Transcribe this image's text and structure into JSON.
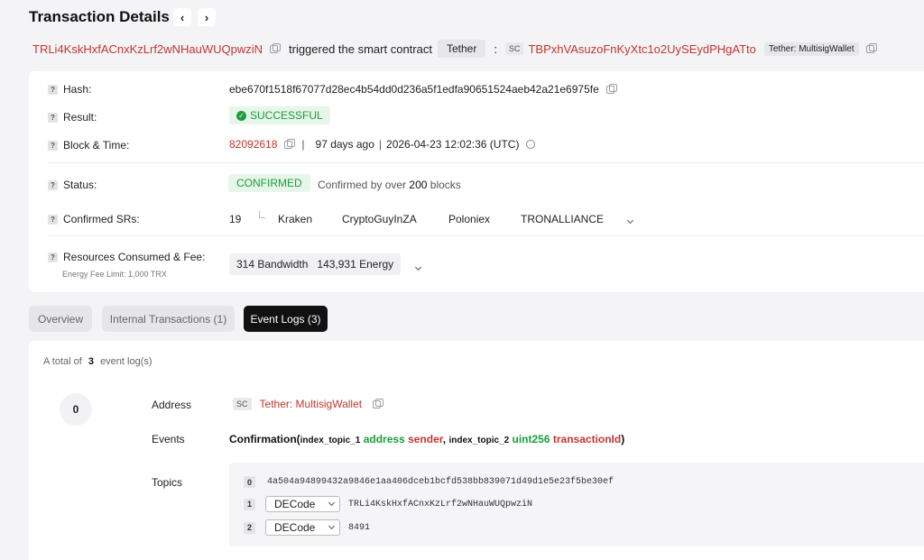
{
  "header": {
    "title": "Transaction Details",
    "prev_icon": "chevron-left",
    "next_icon": "chevron-right",
    "from_address": "TRLi4KskHxfACnxKzLrf2wNHauWUQpwziN",
    "triggered_text": "triggered the smart contract",
    "token_tag": "Tether",
    "colon": ":",
    "sc_label": "SC",
    "contract_address": "TBPxhVAsuzoFnKyXtc1o2UySEydPHgATto",
    "contract_tag": "Tether: MultisigWallet"
  },
  "details": {
    "hash_label": "Hash:",
    "hash_value": "ebe670f1518f67077d28ec4b54dd0d236a5f1edfa90651524aeb42a21e6975fe",
    "result_label": "Result:",
    "result_value": "SUCCESSFUL",
    "block_label": "Block & Time:",
    "block_number": "82092618",
    "sep": "|",
    "days_ago": "97 days ago",
    "timestamp": "2026-04-23 12:02:36 (UTC)",
    "status_label": "Status:",
    "status_value": "CONFIRMED",
    "confirmed_by_prefix": "Confirmed by over",
    "confirmed_count": "200",
    "confirmed_suffix": "blocks",
    "srs_label": "Confirmed SRs:",
    "srs_count": "19",
    "srs": [
      "Kraken",
      "CryptoGuyInZA",
      "Poloniex",
      "TRONALLIANCE"
    ],
    "resources_label": "Resources Consumed & Fee:",
    "energy_fee_limit": "Energy Fee Limit: 1,000 TRX",
    "bandwidth": "314 Bandwidth",
    "energy": "143,931 Energy"
  },
  "tabs": [
    "Overview",
    "Internal Transactions (1)",
    "Event Logs (3)"
  ],
  "events": {
    "total_prefix": "A total of",
    "total_count": "3",
    "total_suffix": "event log(s)",
    "index": "0",
    "address_label": "Address",
    "address_sc": "SC",
    "address_value": "Tether: MultisigWallet",
    "events_label": "Events",
    "event_name": "Confirmation(",
    "param1_name": "index_topic_1",
    "param1_type": "address",
    "param1_var": "sender",
    "comma": ",",
    "param2_name": "index_topic_2",
    "param2_type": "uint256",
    "param2_var": "transactionId",
    "close_paren": ")",
    "topics_label": "Topics",
    "topics": [
      {
        "i": "0",
        "value": "4a504a94899432a9846e1aa406dceb1bcfd538bb839071d49d1e5e23f5be30ef"
      },
      {
        "i": "1",
        "select": "DECode",
        "value": "TRLi4KskHxfACnxKzLrf2wNHauWUQpwziN"
      },
      {
        "i": "2",
        "select": "DECode",
        "value": "8491"
      }
    ]
  }
}
